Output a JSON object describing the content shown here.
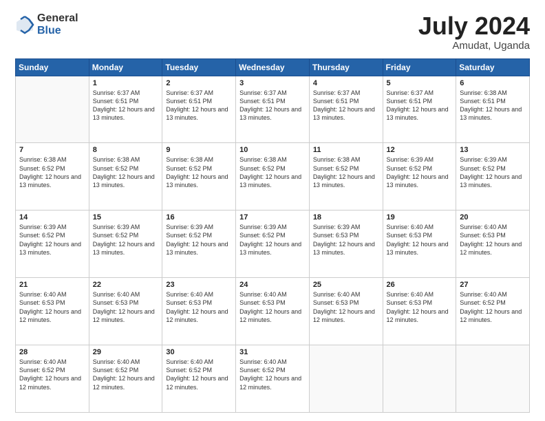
{
  "header": {
    "logo_general": "General",
    "logo_blue": "Blue",
    "month_title": "July 2024",
    "subtitle": "Amudat, Uganda"
  },
  "days_of_week": [
    "Sunday",
    "Monday",
    "Tuesday",
    "Wednesday",
    "Thursday",
    "Friday",
    "Saturday"
  ],
  "weeks": [
    [
      {
        "day": "",
        "info": ""
      },
      {
        "day": "1",
        "info": "Sunrise: 6:37 AM\nSunset: 6:51 PM\nDaylight: 12 hours\nand 13 minutes."
      },
      {
        "day": "2",
        "info": "Sunrise: 6:37 AM\nSunset: 6:51 PM\nDaylight: 12 hours\nand 13 minutes."
      },
      {
        "day": "3",
        "info": "Sunrise: 6:37 AM\nSunset: 6:51 PM\nDaylight: 12 hours\nand 13 minutes."
      },
      {
        "day": "4",
        "info": "Sunrise: 6:37 AM\nSunset: 6:51 PM\nDaylight: 12 hours\nand 13 minutes."
      },
      {
        "day": "5",
        "info": "Sunrise: 6:37 AM\nSunset: 6:51 PM\nDaylight: 12 hours\nand 13 minutes."
      },
      {
        "day": "6",
        "info": "Sunrise: 6:38 AM\nSunset: 6:51 PM\nDaylight: 12 hours\nand 13 minutes."
      }
    ],
    [
      {
        "day": "7",
        "info": "Sunrise: 6:38 AM\nSunset: 6:52 PM\nDaylight: 12 hours\nand 13 minutes."
      },
      {
        "day": "8",
        "info": "Sunrise: 6:38 AM\nSunset: 6:52 PM\nDaylight: 12 hours\nand 13 minutes."
      },
      {
        "day": "9",
        "info": "Sunrise: 6:38 AM\nSunset: 6:52 PM\nDaylight: 12 hours\nand 13 minutes."
      },
      {
        "day": "10",
        "info": "Sunrise: 6:38 AM\nSunset: 6:52 PM\nDaylight: 12 hours\nand 13 minutes."
      },
      {
        "day": "11",
        "info": "Sunrise: 6:38 AM\nSunset: 6:52 PM\nDaylight: 12 hours\nand 13 minutes."
      },
      {
        "day": "12",
        "info": "Sunrise: 6:39 AM\nSunset: 6:52 PM\nDaylight: 12 hours\nand 13 minutes."
      },
      {
        "day": "13",
        "info": "Sunrise: 6:39 AM\nSunset: 6:52 PM\nDaylight: 12 hours\nand 13 minutes."
      }
    ],
    [
      {
        "day": "14",
        "info": "Sunrise: 6:39 AM\nSunset: 6:52 PM\nDaylight: 12 hours\nand 13 minutes."
      },
      {
        "day": "15",
        "info": "Sunrise: 6:39 AM\nSunset: 6:52 PM\nDaylight: 12 hours\nand 13 minutes."
      },
      {
        "day": "16",
        "info": "Sunrise: 6:39 AM\nSunset: 6:52 PM\nDaylight: 12 hours\nand 13 minutes."
      },
      {
        "day": "17",
        "info": "Sunrise: 6:39 AM\nSunset: 6:52 PM\nDaylight: 12 hours\nand 13 minutes."
      },
      {
        "day": "18",
        "info": "Sunrise: 6:39 AM\nSunset: 6:53 PM\nDaylight: 12 hours\nand 13 minutes."
      },
      {
        "day": "19",
        "info": "Sunrise: 6:40 AM\nSunset: 6:53 PM\nDaylight: 12 hours\nand 13 minutes."
      },
      {
        "day": "20",
        "info": "Sunrise: 6:40 AM\nSunset: 6:53 PM\nDaylight: 12 hours\nand 12 minutes."
      }
    ],
    [
      {
        "day": "21",
        "info": "Sunrise: 6:40 AM\nSunset: 6:53 PM\nDaylight: 12 hours\nand 12 minutes."
      },
      {
        "day": "22",
        "info": "Sunrise: 6:40 AM\nSunset: 6:53 PM\nDaylight: 12 hours\nand 12 minutes."
      },
      {
        "day": "23",
        "info": "Sunrise: 6:40 AM\nSunset: 6:53 PM\nDaylight: 12 hours\nand 12 minutes."
      },
      {
        "day": "24",
        "info": "Sunrise: 6:40 AM\nSunset: 6:53 PM\nDaylight: 12 hours\nand 12 minutes."
      },
      {
        "day": "25",
        "info": "Sunrise: 6:40 AM\nSunset: 6:53 PM\nDaylight: 12 hours\nand 12 minutes."
      },
      {
        "day": "26",
        "info": "Sunrise: 6:40 AM\nSunset: 6:53 PM\nDaylight: 12 hours\nand 12 minutes."
      },
      {
        "day": "27",
        "info": "Sunrise: 6:40 AM\nSunset: 6:52 PM\nDaylight: 12 hours\nand 12 minutes."
      }
    ],
    [
      {
        "day": "28",
        "info": "Sunrise: 6:40 AM\nSunset: 6:52 PM\nDaylight: 12 hours\nand 12 minutes."
      },
      {
        "day": "29",
        "info": "Sunrise: 6:40 AM\nSunset: 6:52 PM\nDaylight: 12 hours\nand 12 minutes."
      },
      {
        "day": "30",
        "info": "Sunrise: 6:40 AM\nSunset: 6:52 PM\nDaylight: 12 hours\nand 12 minutes."
      },
      {
        "day": "31",
        "info": "Sunrise: 6:40 AM\nSunset: 6:52 PM\nDaylight: 12 hours\nand 12 minutes."
      },
      {
        "day": "",
        "info": ""
      },
      {
        "day": "",
        "info": ""
      },
      {
        "day": "",
        "info": ""
      }
    ]
  ]
}
